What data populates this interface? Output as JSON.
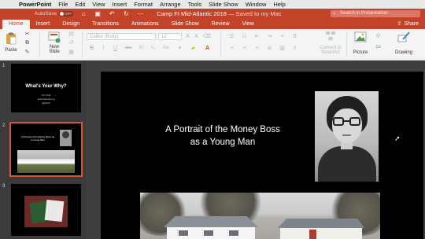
{
  "menubar": {
    "apple": "",
    "items": [
      "PowerPoint",
      "File",
      "Edit",
      "View",
      "Insert",
      "Format",
      "Arrange",
      "Tools",
      "Slide Show",
      "Window",
      "Help"
    ]
  },
  "titlebar": {
    "autosave_label": "AutoSave",
    "autosave_state": "OFF",
    "document_name": "Camp FI Mid-Atlantic 2018",
    "saved_status": "— Saved to my Mac",
    "search_placeholder": "Search in Presentation"
  },
  "tabs": {
    "items": [
      "Home",
      "Insert",
      "Design",
      "Transitions",
      "Animations",
      "Slide Show",
      "Review",
      "View"
    ],
    "active": "Home",
    "share_label": "Share"
  },
  "ribbon": {
    "paste_label": "Paste",
    "new_slide_label": "New\nSlide",
    "font_name": "Calibri (Body)",
    "font_size": "12",
    "convert_label": "Convert to\nSmartArt",
    "picture_label": "Picture",
    "drawing_label": "Drawing",
    "format_buttons": [
      "B",
      "I",
      "U",
      "abc",
      "X²",
      "X₂",
      "Aa"
    ]
  },
  "slides": {
    "numbers": [
      "1",
      "2",
      "3"
    ],
    "slide1": {
      "title": "What's Your Why?",
      "lines": [
        "J.D. Roth",
        "getrichslowly.org",
        "@jdroth"
      ]
    },
    "slide2": {
      "title": "A Portrait of the Money Boss as a Young Man"
    }
  },
  "main_slide": {
    "title_line1": "A Portrait of the Money Boss",
    "title_line2": "as a Young Man"
  },
  "colors": {
    "accent": "#c2422a",
    "selection": "#d4573b",
    "ribbon_bg": "#f4f4f4",
    "pane_bg": "#3b3b3b"
  }
}
